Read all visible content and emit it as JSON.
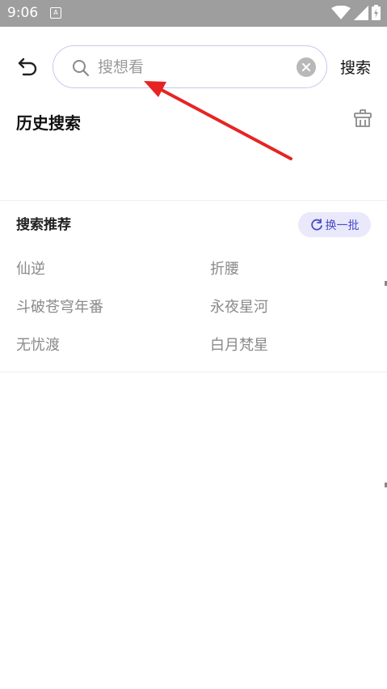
{
  "status_bar": {
    "time": "9:06",
    "app_badge": "A",
    "icons": [
      "wifi-icon",
      "signal-icon",
      "battery-icon"
    ]
  },
  "header": {
    "search_placeholder": "搜想看",
    "search_value": "",
    "submit_label": "搜索"
  },
  "history": {
    "title": "历史搜索",
    "items": []
  },
  "recommend": {
    "title": "搜索推荐",
    "refresh_label": "换一批",
    "items": [
      "仙逆",
      "折腰",
      "斗破苍穹年番",
      "永夜星河",
      "无忧渡",
      "白月梵星"
    ]
  },
  "colors": {
    "status_bar_bg": "#9e9e9e",
    "search_border": "#c8c8ef",
    "refresh_bg": "#e9e9fb",
    "refresh_text": "#4a4ac8",
    "annotation_arrow": "#e62424"
  }
}
